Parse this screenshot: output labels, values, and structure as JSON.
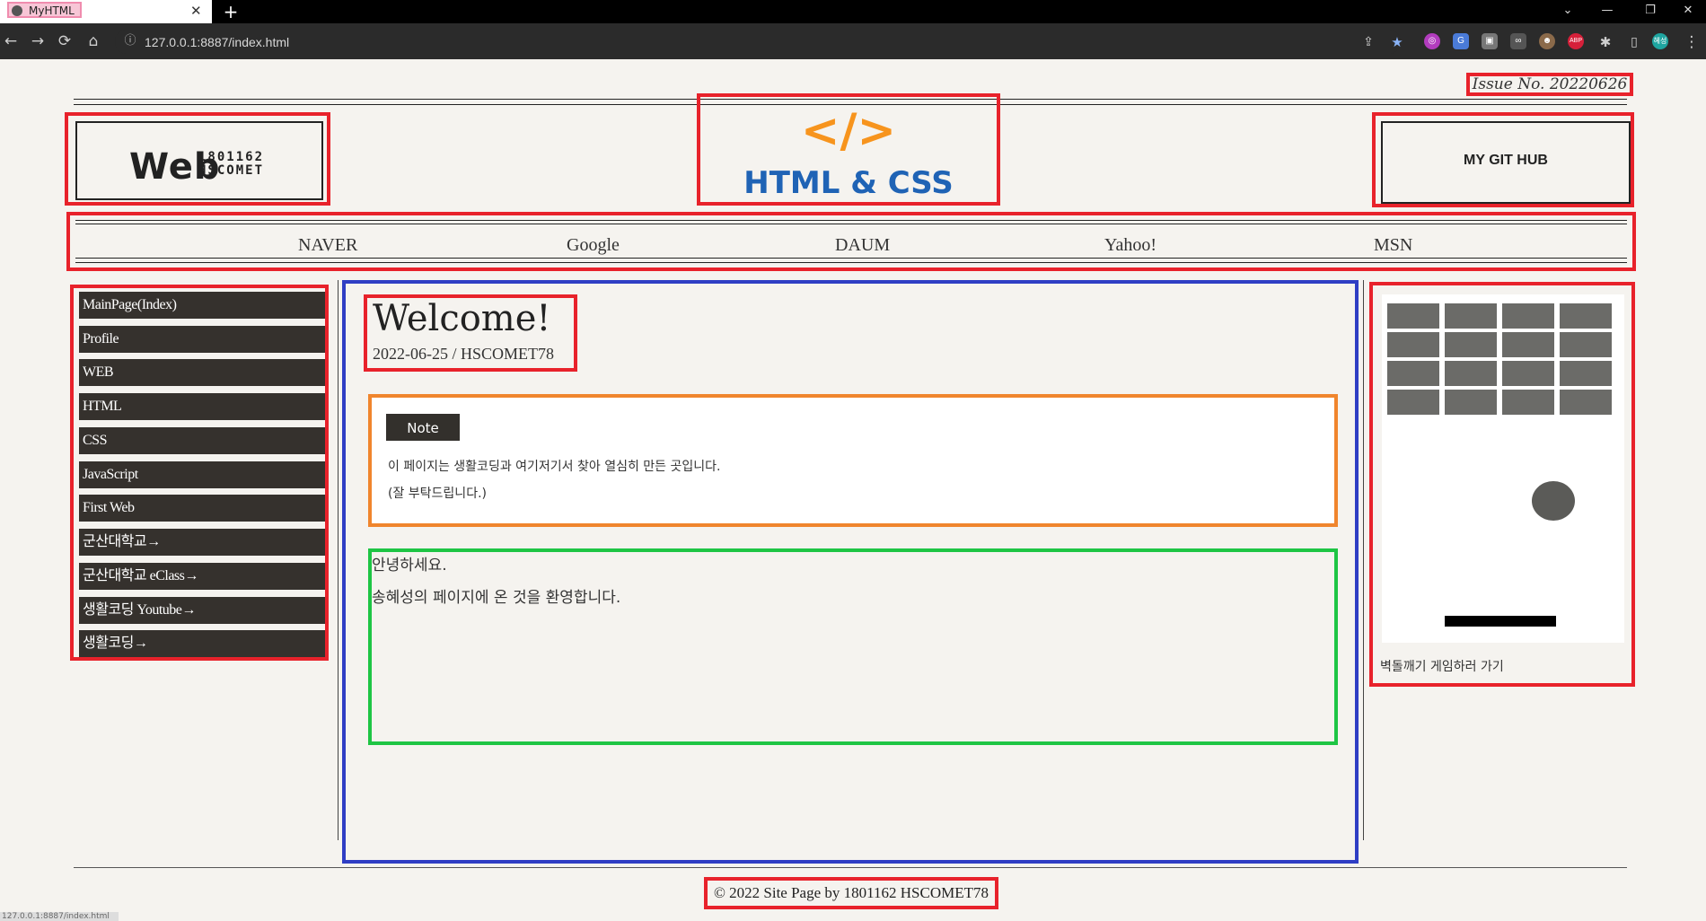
{
  "browser": {
    "tab_title": "MyHTML",
    "url": "127.0.0.1:8887/index.html",
    "status_url": "127.0.0.1:8887/index.html"
  },
  "issue": "Issue No. 20220626",
  "logo": {
    "main": "Web",
    "id": "1801162",
    "name": "HSCOMET"
  },
  "center_logo": {
    "code": "</>",
    "text": "HTML & CSS"
  },
  "github_label": "MY GIT HUB",
  "top_nav": [
    "NAVER",
    "Google",
    "DAUM",
    "Yahoo!",
    "MSN"
  ],
  "sidebar": [
    "MainPage(Index)",
    "Profile",
    "WEB",
    "HTML",
    "CSS",
    "JavaScript",
    "First Web",
    "군산대학교→",
    "군산대학교 eClass→",
    "생활코딩 Youtube→",
    "생활코딩→"
  ],
  "article": {
    "title": "Welcome!",
    "meta": "2022-06-25 / HSCOMET78"
  },
  "note": {
    "badge": "Note",
    "line1": "이 페이지는 생활코딩과 여기저기서 찾아 열심히 만든 곳입니다.",
    "line2": "(잘 부탁드립니다.)"
  },
  "greeting": {
    "line1": "안녕하세요.",
    "line2": "송혜성의 페이지에 온 것을 환영합니다."
  },
  "game": {
    "link": "벽돌깨기 게임하러 가기",
    "brick_color": "#6b6b68",
    "ball_color": "#5b5b58"
  },
  "footer": "© 2022 Site Page by 1801162 HSCOMET78",
  "colors": {
    "red_box": "#e8222b",
    "blue_box": "#2f3ec4",
    "orange_box": "#f0852d",
    "green_box": "#1ec544",
    "sidebar_bg": "#35312d",
    "logo_orange": "#f7941d",
    "logo_blue": "#1f63b5"
  }
}
